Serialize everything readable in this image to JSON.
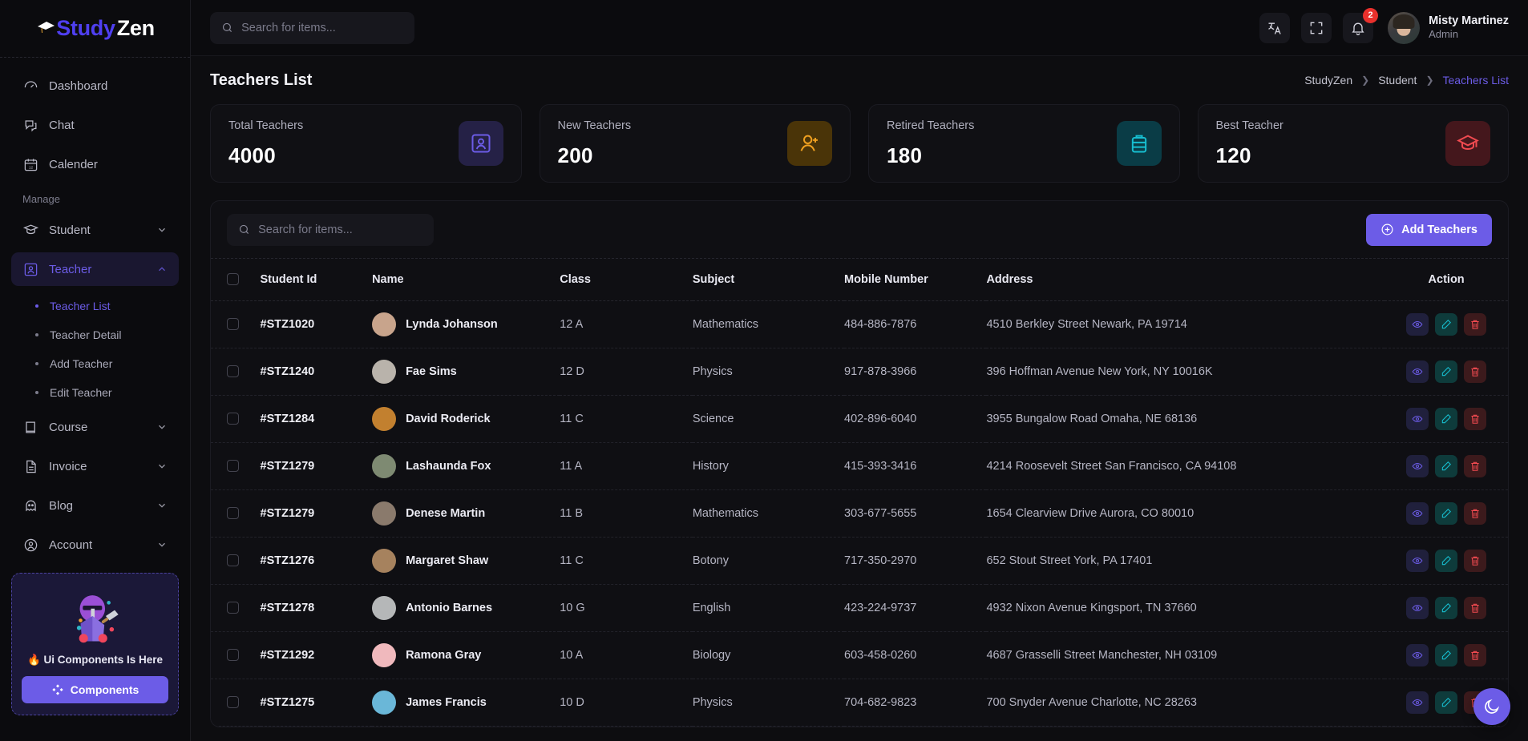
{
  "brand": {
    "name_part1": "Study",
    "name_part2": "Zen"
  },
  "topbar": {
    "search_placeholder": "Search for items...",
    "notification_count": "2",
    "user_name": "Misty Martinez",
    "user_role": "Admin"
  },
  "sidebar": {
    "items": [
      {
        "label": "Dashboard",
        "icon": "dashboard-icon"
      },
      {
        "label": "Chat",
        "icon": "chat-icon"
      },
      {
        "label": "Calender",
        "icon": "calendar-icon"
      }
    ],
    "section_label": "Manage",
    "manage_items": [
      {
        "label": "Student",
        "icon": "student-cap-icon",
        "expanded": false
      },
      {
        "label": "Teacher",
        "icon": "teacher-icon",
        "expanded": true
      },
      {
        "label": "Course",
        "icon": "book-icon",
        "expanded": false
      },
      {
        "label": "Invoice",
        "icon": "document-icon",
        "expanded": false
      },
      {
        "label": "Blog",
        "icon": "ghost-icon",
        "expanded": false
      },
      {
        "label": "Account",
        "icon": "user-circle-icon",
        "expanded": false
      }
    ],
    "teacher_submenu": [
      {
        "label": "Teacher List",
        "active": true
      },
      {
        "label": "Teacher Detail",
        "active": false
      },
      {
        "label": "Add Teacher",
        "active": false
      },
      {
        "label": "Edit Teacher",
        "active": false
      }
    ],
    "promo": {
      "title": "🔥 Ui Components Is Here",
      "button_label": "Components"
    }
  },
  "page": {
    "title": "Teachers List",
    "breadcrumb": [
      {
        "label": "StudyZen",
        "current": false
      },
      {
        "label": "Student",
        "current": false
      },
      {
        "label": "Teachers List",
        "current": true
      }
    ]
  },
  "stats": [
    {
      "label": "Total Teachers",
      "value": "4000",
      "icon": "teacher-frame-icon",
      "color": "#6c5ce7",
      "bg": "#252146"
    },
    {
      "label": "New Teachers",
      "value": "200",
      "icon": "user-plus-icon",
      "color": "#f0a020",
      "bg": "#4a3408"
    },
    {
      "label": "Retired Teachers",
      "value": "180",
      "icon": "briefcase-icon",
      "color": "#17bed0",
      "bg": "#0a3c46"
    },
    {
      "label": "Best Teacher",
      "value": "120",
      "icon": "graduation-cap-icon",
      "color": "#f04a50",
      "bg": "#44171c"
    }
  ],
  "table": {
    "search_placeholder": "Search for items...",
    "add_button": "Add Teachers",
    "columns": [
      "Student Id",
      "Name",
      "Class",
      "Subject",
      "Mobile Number",
      "Address",
      "Action"
    ],
    "rows": [
      {
        "id": "#STZ1020",
        "name": "Lynda Johanson",
        "class": "12 A",
        "subject": "Mathematics",
        "mobile": "484-886-7876",
        "address": "4510 Berkley Street Newark, PA 19714",
        "avatar": "#c8a48c"
      },
      {
        "id": "#STZ1240",
        "name": "Fae Sims",
        "class": "12 D",
        "subject": "Physics",
        "mobile": "917-878-3966",
        "address": "396 Hoffman Avenue New York, NY 10016K",
        "avatar": "#b9b3ab"
      },
      {
        "id": "#STZ1284",
        "name": "David Roderick",
        "class": "11 C",
        "subject": "Science",
        "mobile": "402-896-6040",
        "address": "3955 Bungalow Road Omaha, NE 68136",
        "avatar": "#c2802f"
      },
      {
        "id": "#STZ1279",
        "name": "Lashaunda Fox",
        "class": "11 A",
        "subject": "History",
        "mobile": "415-393-3416",
        "address": "4214 Roosevelt Street San Francisco, CA 94108",
        "avatar": "#7e8a72"
      },
      {
        "id": "#STZ1279",
        "name": "Denese Martin",
        "class": "11 B",
        "subject": "Mathematics",
        "mobile": "303-677-5655",
        "address": "1654 Clearview Drive Aurora, CO 80010",
        "avatar": "#8a7a6c"
      },
      {
        "id": "#STZ1276",
        "name": "Margaret Shaw",
        "class": "11 C",
        "subject": "Botony",
        "mobile": "717-350-2970",
        "address": "652 Stout Street York, PA 17401",
        "avatar": "#a6825e"
      },
      {
        "id": "#STZ1278",
        "name": "Antonio Barnes",
        "class": "10 G",
        "subject": "English",
        "mobile": "423-224-9737",
        "address": "4932 Nixon Avenue Kingsport, TN 37660",
        "avatar": "#b5b7b8"
      },
      {
        "id": "#STZ1292",
        "name": "Ramona Gray",
        "class": "10 A",
        "subject": "Biology",
        "mobile": "603-458-0260",
        "address": "4687 Grasselli Street Manchester, NH 03109",
        "avatar": "#f0b9bd"
      },
      {
        "id": "#STZ1275",
        "name": "James Francis",
        "class": "10 D",
        "subject": "Physics",
        "mobile": "704-682-9823",
        "address": "700 Snyder Avenue Charlotte, NC 28263",
        "avatar": "#6ab7d8"
      }
    ],
    "action_labels": {
      "view": "View",
      "edit": "Edit",
      "delete": "Delete"
    }
  },
  "fab": {
    "icon": "moon-icon"
  }
}
